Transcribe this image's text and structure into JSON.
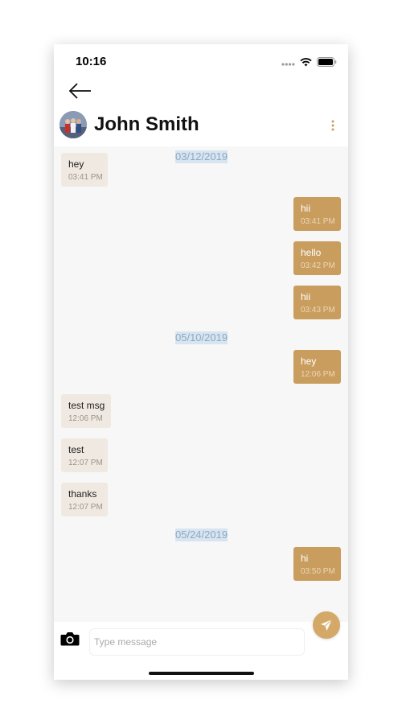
{
  "status_bar": {
    "time": "10:16"
  },
  "header": {
    "contact_name": "John Smith"
  },
  "colors": {
    "accent": "#c99d5e",
    "incoming_bubble": "#efe9e1",
    "date_label_bg": "#d8e5f0",
    "date_label_text": "#8aa9c4",
    "chat_background": "#f7f7f7"
  },
  "icons": {
    "back": "arrow-left-icon",
    "more": "more-vertical-icon",
    "camera": "camera-icon",
    "send": "send-icon"
  },
  "chat": {
    "date_labels": [
      "03/12/2019",
      "05/10/2019",
      "05/24/2019"
    ],
    "messages": [
      {
        "direction": "incoming",
        "text": "hey",
        "time": "03:41 PM"
      },
      {
        "direction": "outgoing",
        "text": "hii",
        "time": "03:41 PM"
      },
      {
        "direction": "outgoing",
        "text": "hello",
        "time": "03:42 PM"
      },
      {
        "direction": "outgoing",
        "text": "hii",
        "time": "03:43 PM"
      },
      {
        "direction": "outgoing",
        "text": "hey",
        "time": "12:06 PM"
      },
      {
        "direction": "incoming",
        "text": "test msg",
        "time": "12:06 PM"
      },
      {
        "direction": "incoming",
        "text": "test",
        "time": "12:07 PM"
      },
      {
        "direction": "incoming",
        "text": "thanks",
        "time": "12:07 PM"
      },
      {
        "direction": "outgoing",
        "text": "hi",
        "time": "03:50 PM"
      }
    ]
  },
  "composer": {
    "placeholder": "Type message",
    "value": ""
  }
}
